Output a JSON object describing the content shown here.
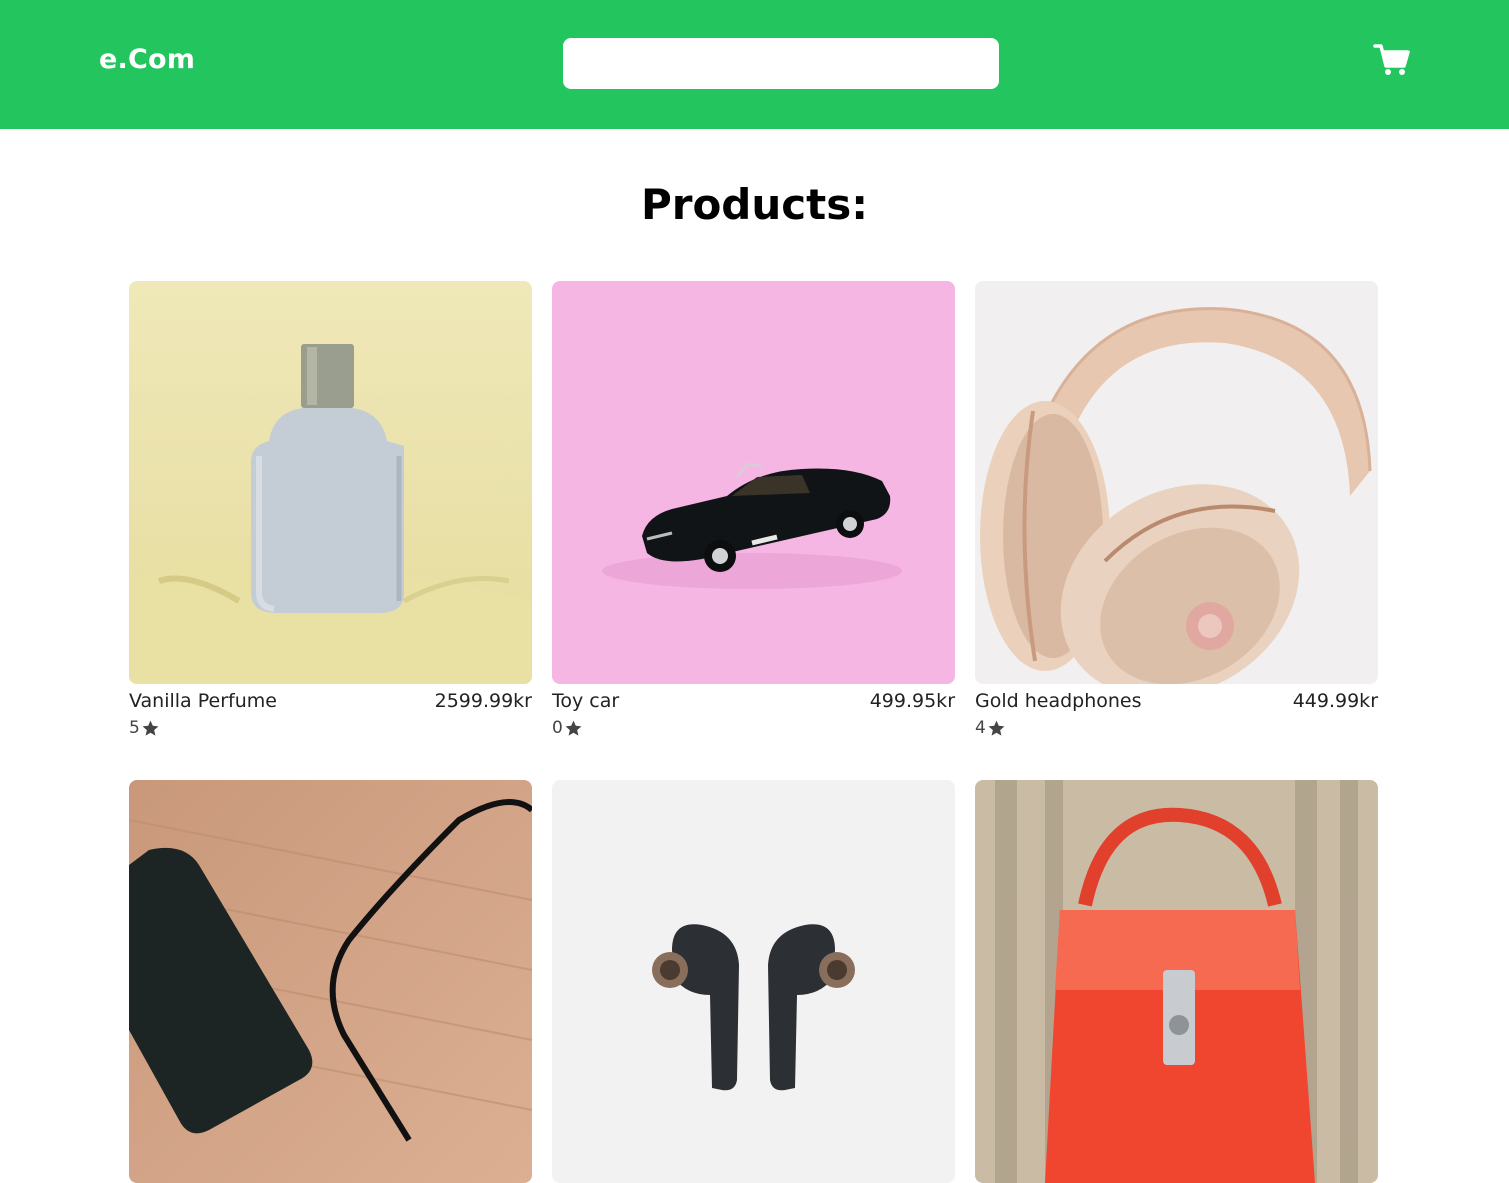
{
  "header": {
    "brand": "e.Com",
    "search_placeholder": "",
    "cart_icon": "shopping-cart-icon",
    "accent_color": "#22c55e"
  },
  "main": {
    "title": "Products:"
  },
  "products": [
    {
      "name": "Vanilla Perfume",
      "price": "2599.99kr",
      "rating": "5",
      "image": "perfume-bottle-image"
    },
    {
      "name": "Toy car",
      "price": "499.95kr",
      "rating": "0",
      "image": "toy-car-image"
    },
    {
      "name": "Gold headphones",
      "price": "449.99kr",
      "rating": "4",
      "image": "headphones-image"
    },
    {
      "image": "phone-charger-image"
    },
    {
      "image": "earbuds-image"
    },
    {
      "image": "handbag-image"
    }
  ]
}
